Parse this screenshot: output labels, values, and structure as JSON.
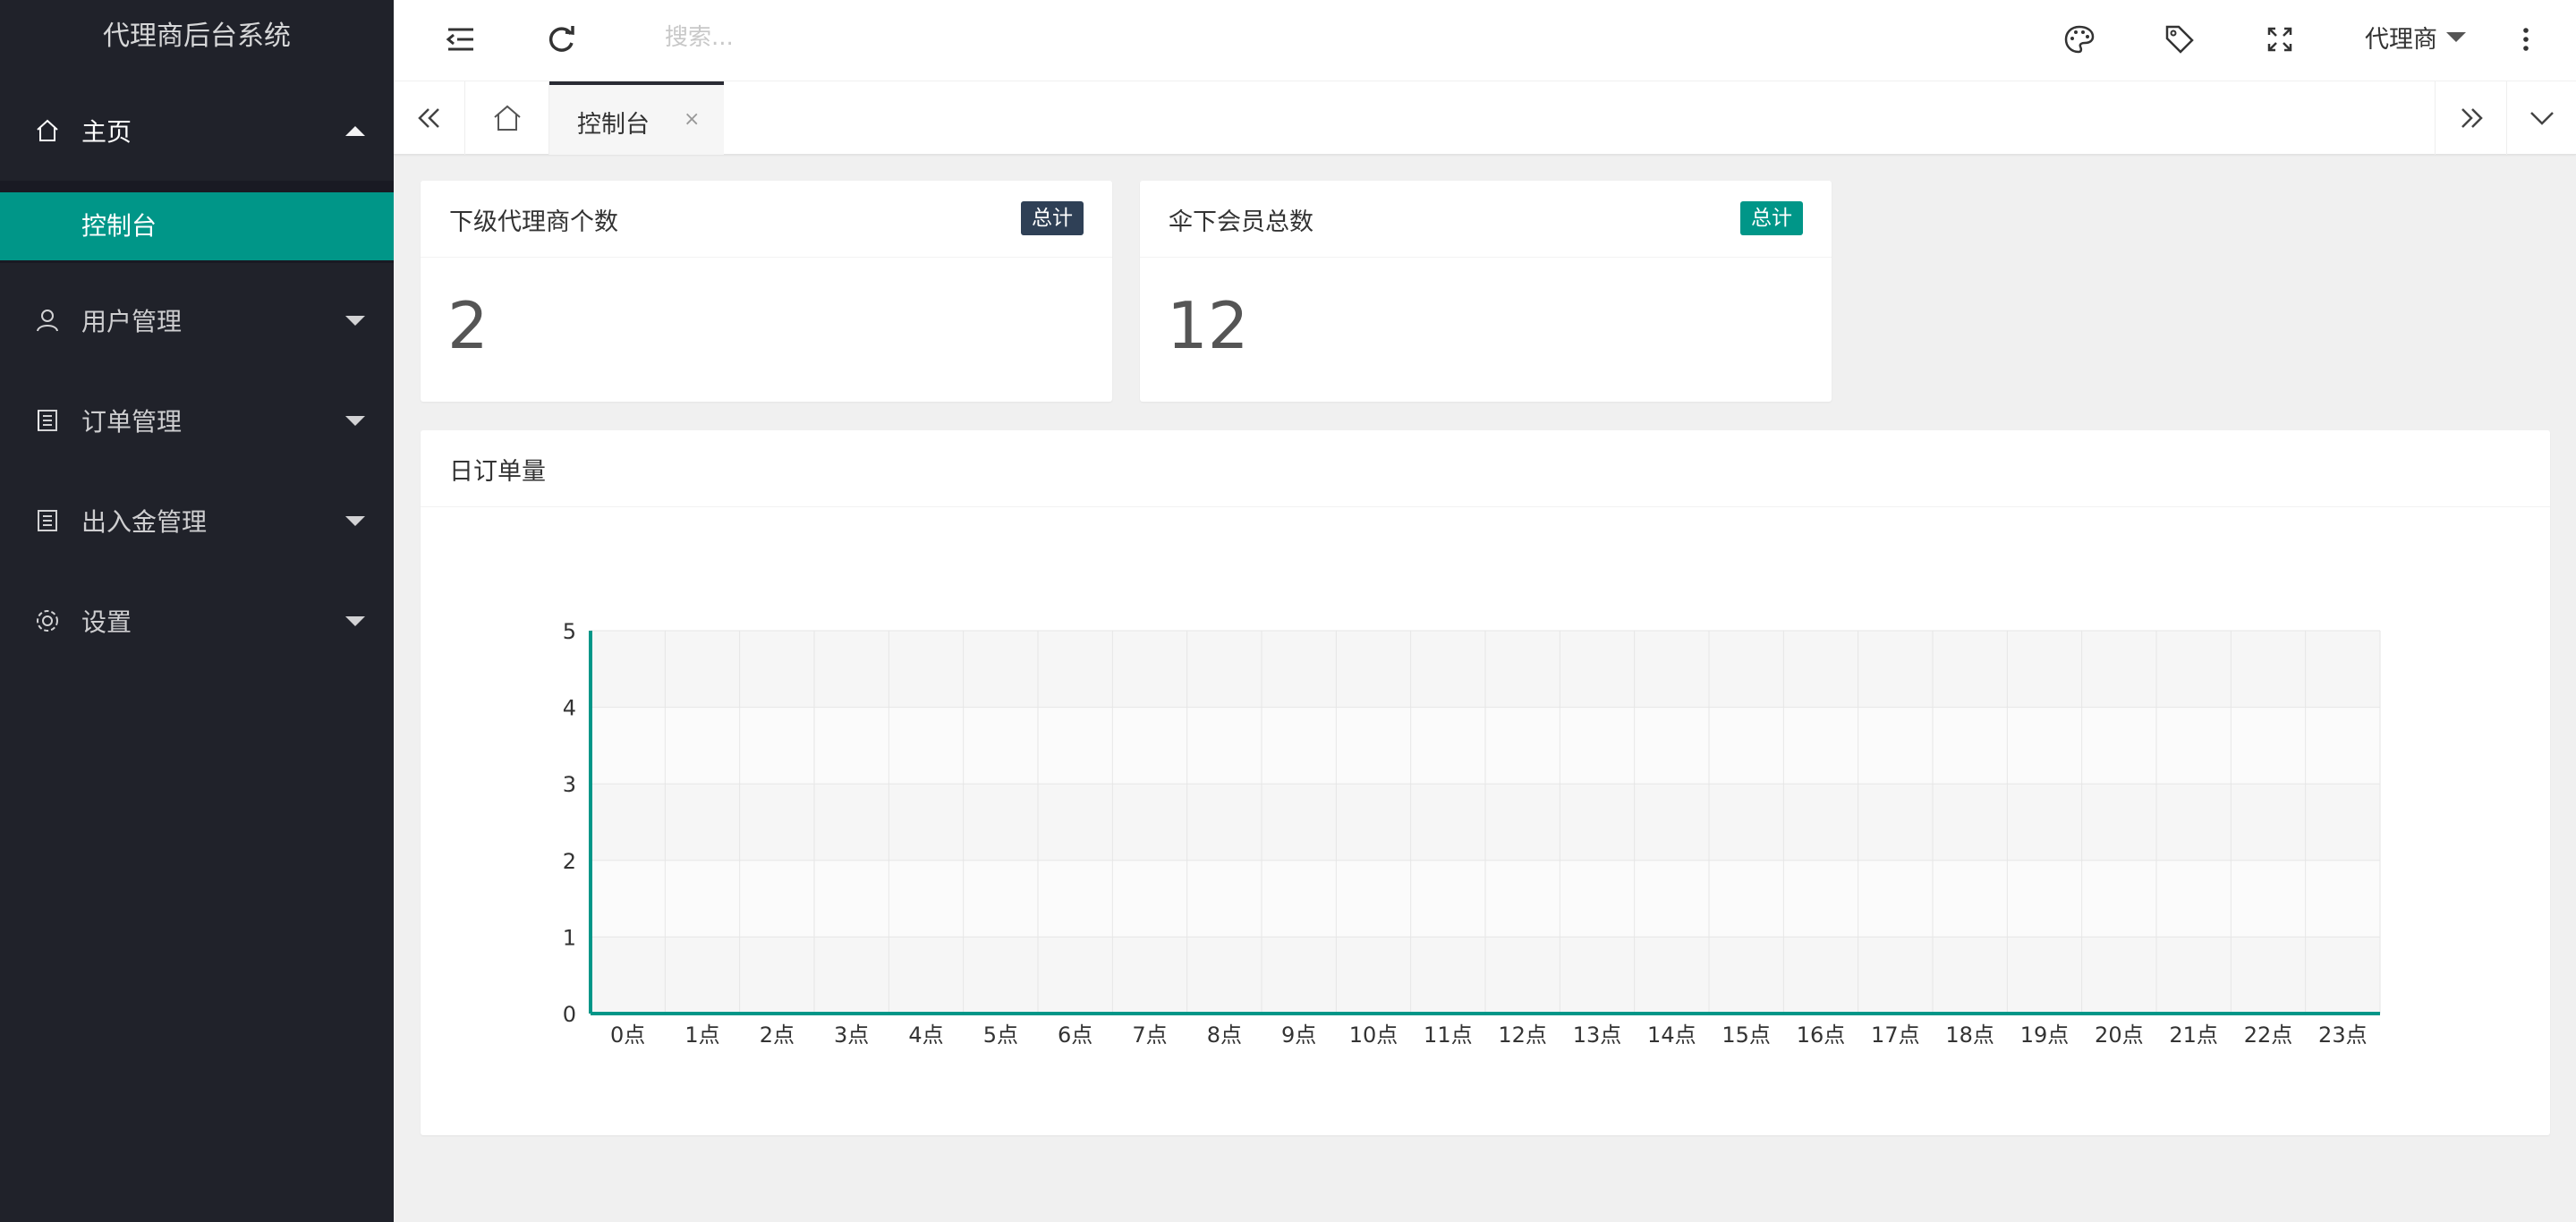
{
  "app": {
    "title": "代理商后台系统"
  },
  "sidebar": {
    "items": [
      {
        "label": "主页",
        "icon": "home-icon",
        "expanded": true,
        "children": [
          {
            "label": "控制台",
            "active": true
          }
        ]
      },
      {
        "label": "用户管理",
        "icon": "user-icon",
        "expanded": false
      },
      {
        "label": "订单管理",
        "icon": "list-icon",
        "expanded": false
      },
      {
        "label": "出入金管理",
        "icon": "list-icon",
        "expanded": false
      },
      {
        "label": "设置",
        "icon": "gear-icon",
        "expanded": false
      }
    ]
  },
  "header": {
    "search_placeholder": "搜索...",
    "user_label": "代理商",
    "icons": [
      "collapse-menu-icon",
      "refresh-icon",
      "palette-icon",
      "tag-icon",
      "fullscreen-icon",
      "more-vertical-icon"
    ]
  },
  "tabs": {
    "items": [
      {
        "label": "控制台",
        "close": "×",
        "active": true
      }
    ]
  },
  "cards": [
    {
      "title": "下级代理商个数",
      "badge": "总计",
      "badge_color": "#2f4056",
      "value": "2"
    },
    {
      "title": "伞下会员总数",
      "badge": "总计",
      "badge_color": "#009688",
      "value": "12"
    }
  ],
  "chart_card": {
    "title": "日订单量"
  },
  "chart_data": {
    "type": "line",
    "title": "",
    "xlabel": "",
    "ylabel": "",
    "categories": [
      "0点",
      "1点",
      "2点",
      "3点",
      "4点",
      "5点",
      "6点",
      "7点",
      "8点",
      "9点",
      "10点",
      "11点",
      "12点",
      "13点",
      "14点",
      "15点",
      "16点",
      "17点",
      "18点",
      "19点",
      "20点",
      "21点",
      "22点",
      "23点"
    ],
    "series": [
      {
        "values": [
          0,
          0,
          0,
          0,
          0,
          0,
          0,
          0,
          0,
          0,
          0,
          0,
          0,
          0,
          0,
          0,
          0,
          0,
          0,
          0,
          0,
          0,
          0,
          0
        ]
      }
    ],
    "ylim": [
      0,
      5
    ],
    "yticks": [
      0,
      1,
      2,
      3,
      4,
      5
    ],
    "grid": true,
    "line_color": "#009688"
  },
  "colors": {
    "sidebar_bg": "#20222a",
    "accent": "#009688"
  }
}
